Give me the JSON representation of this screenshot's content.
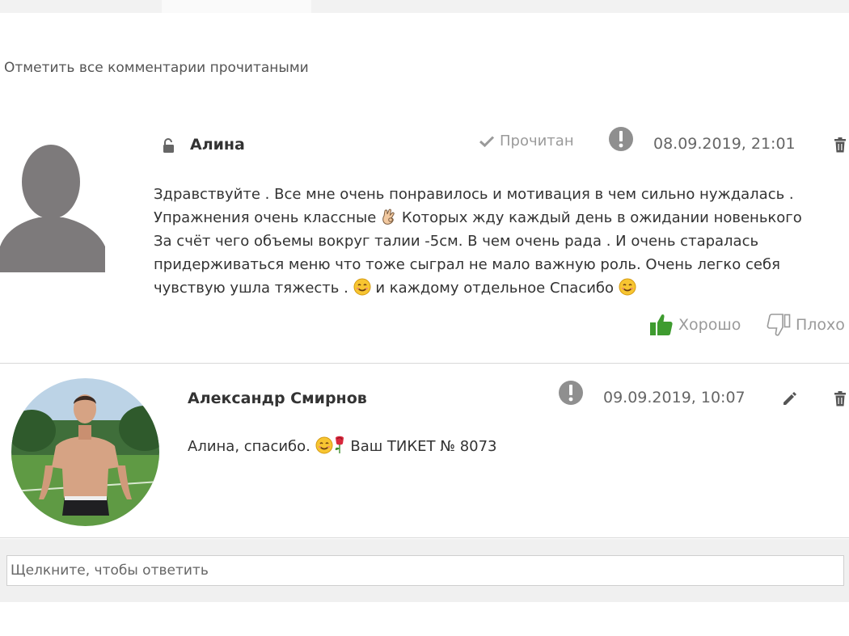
{
  "page": {
    "mark_all_read": "Отметить все комментарии прочитаными"
  },
  "comments": [
    {
      "author": "Алина",
      "status": "Прочитан",
      "timestamp": "08.09.2019, 21:01",
      "lines": [
        "Здравствуйте . Все мне очень понравилось и мотивация в чем сильно нуждалась .",
        "Упражнения очень классные",
        "Которых жду каждый день в ожидании новенького",
        "За счёт чего объемы вокруг талии -5см. В чем очень рада . И очень старалась",
        "придерживаться меню что тоже сыграл не мало важную роль. Очень легко себя",
        "чувствую ушла тяжесть .",
        "и каждому отдельное Спасибо"
      ],
      "vote_good": "Хорошо",
      "vote_bad": "Плохо",
      "icons": [
        "unlock-icon",
        "check-icon",
        "alert-icon",
        "trash-icon",
        "thumbs-up-icon",
        "thumbs-down-icon",
        "ok-hand-emoji",
        "smile-emoji"
      ]
    },
    {
      "author": "Александр Смирнов",
      "timestamp": "09.09.2019, 10:07",
      "text_prefix": "Алина, спасибо.",
      "text_suffix": "Ваш ТИКЕТ № 8073",
      "icons": [
        "alert-icon",
        "pencil-icon",
        "trash-icon",
        "smile-emoji",
        "rose-emoji"
      ]
    }
  ],
  "reply": {
    "placeholder": "Щелкните, чтобы ответить"
  },
  "colors": {
    "text": "#333333",
    "muted": "#9a9a9a",
    "like_green": "#3e9b2f",
    "avatar_gray": "#7d7a7b"
  }
}
